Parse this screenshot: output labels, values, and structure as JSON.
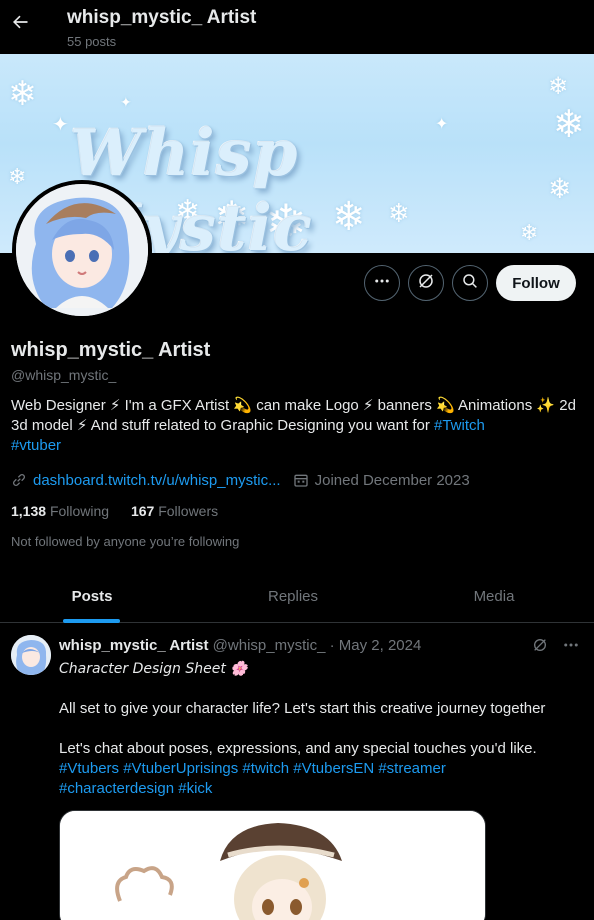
{
  "header": {
    "title": "whisp_mystic_ Artist",
    "posts_count": "55 posts",
    "back_icon": "arrow-left-icon"
  },
  "banner": {
    "text": "Whisp Mystic",
    "colors": {
      "sky": "#c9e8fb",
      "text": "#dbeffc"
    }
  },
  "actions": {
    "more_icon": "more-dots-icon",
    "grok_icon": "grok-icon",
    "search_icon": "search-icon",
    "follow_label": "Follow"
  },
  "profile": {
    "name": "whisp_mystic_ Artist",
    "handle": "@whisp_mystic_",
    "bio_part1": "Web Designer ⚡ I'm a GFX Artist 💫 can make Logo ⚡ banners 💫 Animations ✨ 2d 3d model ⚡  And stuff related to Graphic Designing you want for ",
    "bio_tag1": "#Twitch",
    "bio_tag2": "#vtuber",
    "website": "dashboard.twitch.tv/u/whisp_mystic...",
    "joined": "Joined December 2023",
    "following_count": "1,138",
    "following_label": "Following",
    "followers_count": "167",
    "followers_label": "Followers",
    "not_followed": "Not followed by anyone you’re following"
  },
  "tabs": [
    {
      "label": "Posts",
      "active": true
    },
    {
      "label": "Replies",
      "active": false
    },
    {
      "label": "Media",
      "active": false
    }
  ],
  "post": {
    "author_name": "whisp_mystic_ Artist",
    "author_handle": "@whisp_mystic_",
    "date": "May 2, 2024",
    "title": "Character Design Sheet 🌸",
    "line1": "All set to give your character life? Let's start this creative journey together",
    "line2": "Let's chat about poses, expressions, and any special touches you'd like.",
    "hashtags_line1": "#Vtubers #VtuberUprisings #twitch #VtubersEN #streamer",
    "hashtags_line2": "#characterdesign #kick"
  },
  "colors": {
    "accent": "#1d9bf0",
    "background": "#000000",
    "text": "#e7e9ea",
    "muted": "#71767b"
  }
}
